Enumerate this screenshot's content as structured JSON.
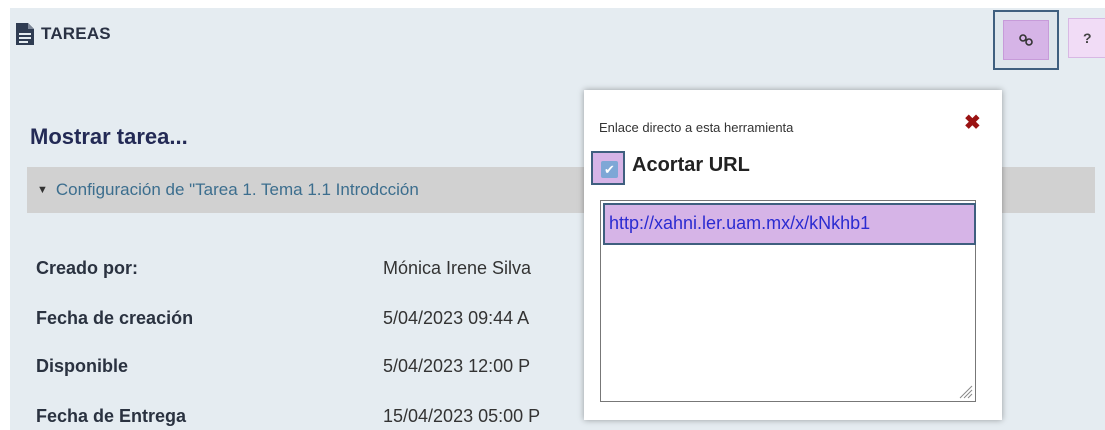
{
  "header": {
    "title": "TAREAS",
    "icon": "document-icon",
    "link_button_icon": "link-icon",
    "help_label": "?"
  },
  "page": {
    "heading": "Mostrar tarea...",
    "config_label": "Configuración de \"Tarea 1.  Tema 1.1 Introdcción"
  },
  "details": [
    {
      "label": "Creado por:",
      "value": "Mónica Irene Silva"
    },
    {
      "label": "Fecha de creación",
      "value": "5/04/2023 09:44 A"
    },
    {
      "label": "Disponible",
      "value": "5/04/2023 12:00 P"
    },
    {
      "label": "Fecha de Entrega",
      "value": "15/04/2023 05:00 P"
    }
  ],
  "popup": {
    "title": "Enlace directo a esta herramienta",
    "close_symbol": "✖",
    "checkbox_label": "Acortar URL",
    "checkbox_checked": true,
    "url": "http://xahni.ler.uam.mx/x/kNkhb1"
  },
  "colors": {
    "highlight": "#d6b4e7",
    "highlight_border": "#3f5f7f",
    "close": "#9a1212",
    "link_text": "#2b2bd1"
  }
}
